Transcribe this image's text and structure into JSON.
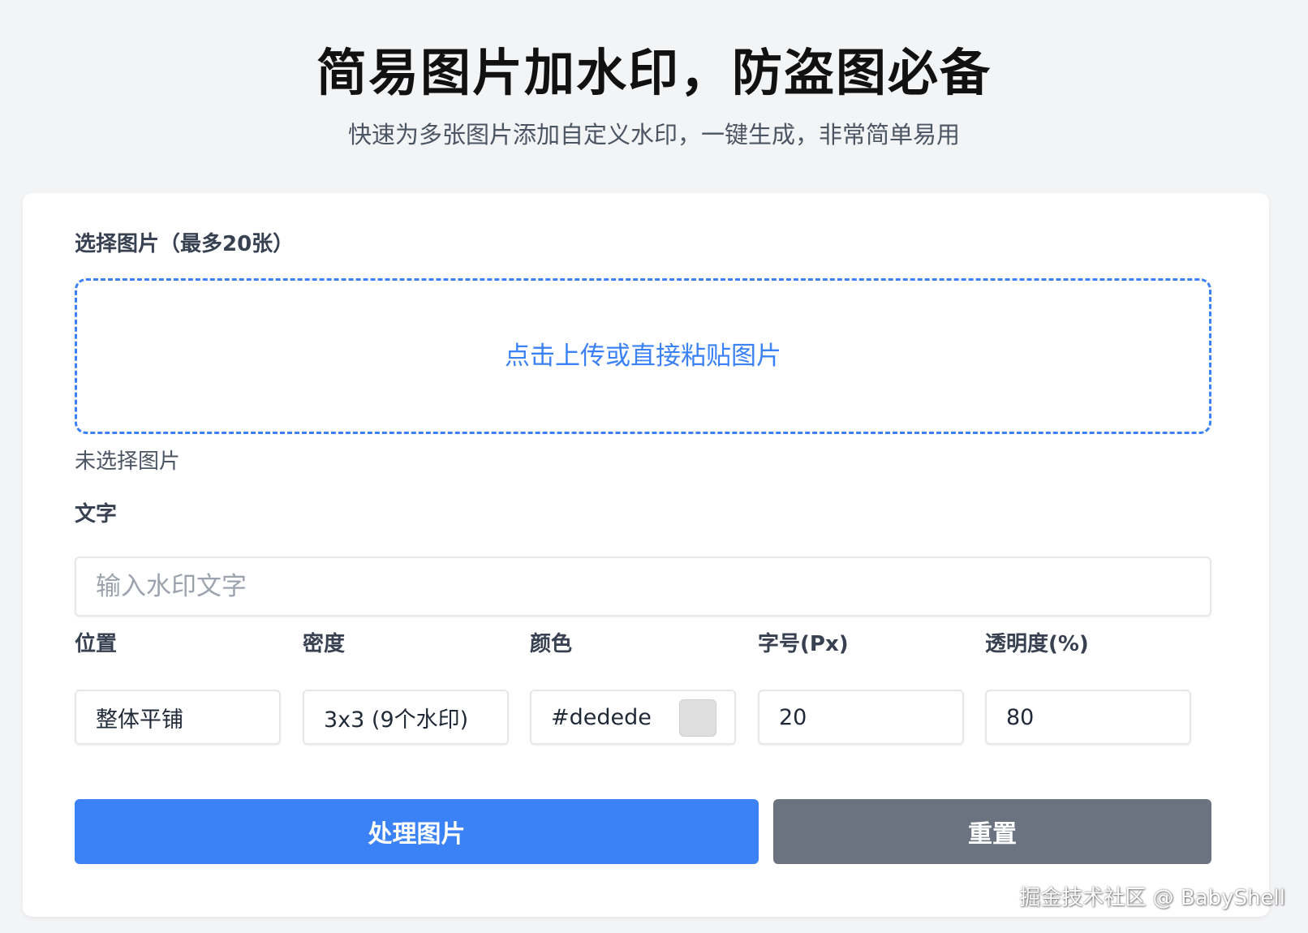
{
  "header": {
    "title": "简易图片加水印，防盗图必备",
    "subtitle": "快速为多张图片添加自定义水印，一键生成，非常简单易用"
  },
  "upload": {
    "label": "选择图片（最多20张）",
    "prompt": "点击上传或直接粘贴图片",
    "status": "未选择图片"
  },
  "text_field": {
    "label": "文字",
    "placeholder": "输入水印文字",
    "value": ""
  },
  "settings": {
    "position": {
      "label": "位置",
      "value": "整体平铺"
    },
    "density": {
      "label": "密度",
      "value": "3x3 (9个水印)"
    },
    "color": {
      "label": "颜色",
      "value": "#dedede",
      "swatch": "#dedede"
    },
    "font_size": {
      "label": "字号(Px)",
      "value": "20"
    },
    "opacity": {
      "label": "透明度(%)",
      "value": "80"
    }
  },
  "actions": {
    "process_label": "处理图片",
    "reset_label": "重置"
  },
  "colors": {
    "primary": "#3b82f6",
    "secondary": "#6b7280",
    "background": "#f3f4f6"
  },
  "watermark_credit": "掘金技术社区 @ BabyShell"
}
